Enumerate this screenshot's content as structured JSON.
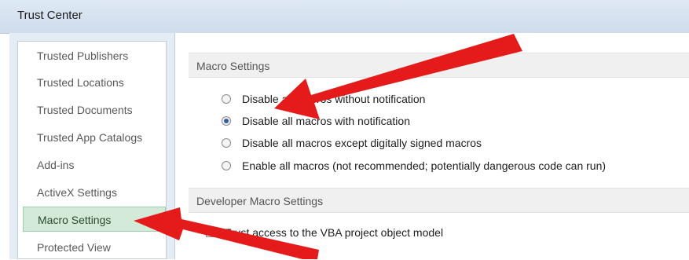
{
  "window": {
    "title": "Trust Center"
  },
  "sidebar": {
    "items": [
      {
        "label": "Trusted Publishers",
        "selected": false
      },
      {
        "label": "Trusted Locations",
        "selected": false
      },
      {
        "label": "Trusted Documents",
        "selected": false
      },
      {
        "label": "Trusted App Catalogs",
        "selected": false
      },
      {
        "label": "Add-ins",
        "selected": false
      },
      {
        "label": "ActiveX Settings",
        "selected": false
      },
      {
        "label": "Macro Settings",
        "selected": true
      },
      {
        "label": "Protected View",
        "selected": false
      }
    ]
  },
  "macro_settings": {
    "header": "Macro Settings",
    "options": [
      {
        "label": "Disable all macros without notification",
        "checked": false
      },
      {
        "label": "Disable all macros with notification",
        "checked": true
      },
      {
        "label": "Disable all macros except digitally signed macros",
        "checked": false
      },
      {
        "label": "Enable all macros (not recommended; potentially dangerous code can run)",
        "checked": false
      }
    ]
  },
  "developer_settings": {
    "header": "Developer Macro Settings",
    "trust_vba_label": "Trust access to the VBA project object model",
    "trust_vba_checked": false
  },
  "annotation_color": "#e51b1b"
}
